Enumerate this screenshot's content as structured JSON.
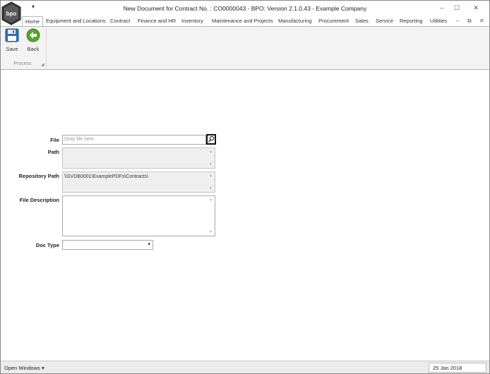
{
  "window": {
    "title": "New Document for Contract No. : CO0000043 - BPO: Version 2.1.0.43 - Example Company",
    "logo_text": "bpo",
    "qat_icon": "dropdown-arrow",
    "minimize": "–",
    "maximize": "☐",
    "close": "✕"
  },
  "tabs": [
    "Home",
    "Equipment and Locations",
    "Contract",
    "Finance and HR",
    "Inventory",
    "Maintenance and Projects",
    "Manufacturing",
    "Procurement",
    "Sales",
    "Service",
    "Reporting",
    "Utilities"
  ],
  "tab_controls": {
    "collapse": "–",
    "restore": "⧉",
    "close": "✕"
  },
  "ribbon": {
    "save_label": "Save",
    "back_label": "Back",
    "group_label": "Process"
  },
  "form": {
    "file_label": "File",
    "file_placeholder": "Drop file here",
    "path_label": "Path",
    "path_value": "",
    "repo_label": "Repository Path",
    "repo_value": "\\\\SVDB0001\\ExamplePDFs\\Contracts\\",
    "desc_label": "File Description",
    "desc_value": "",
    "doctype_label": "Doc Type",
    "doctype_value": ""
  },
  "statusbar": {
    "open_windows": "Open Windows ▾",
    "date": "25 Jan 2018"
  },
  "colors": {
    "save_icon": "#2e6fb5",
    "back_icon": "#5aa52c",
    "ribbon_bg": "#f3f3f3"
  }
}
